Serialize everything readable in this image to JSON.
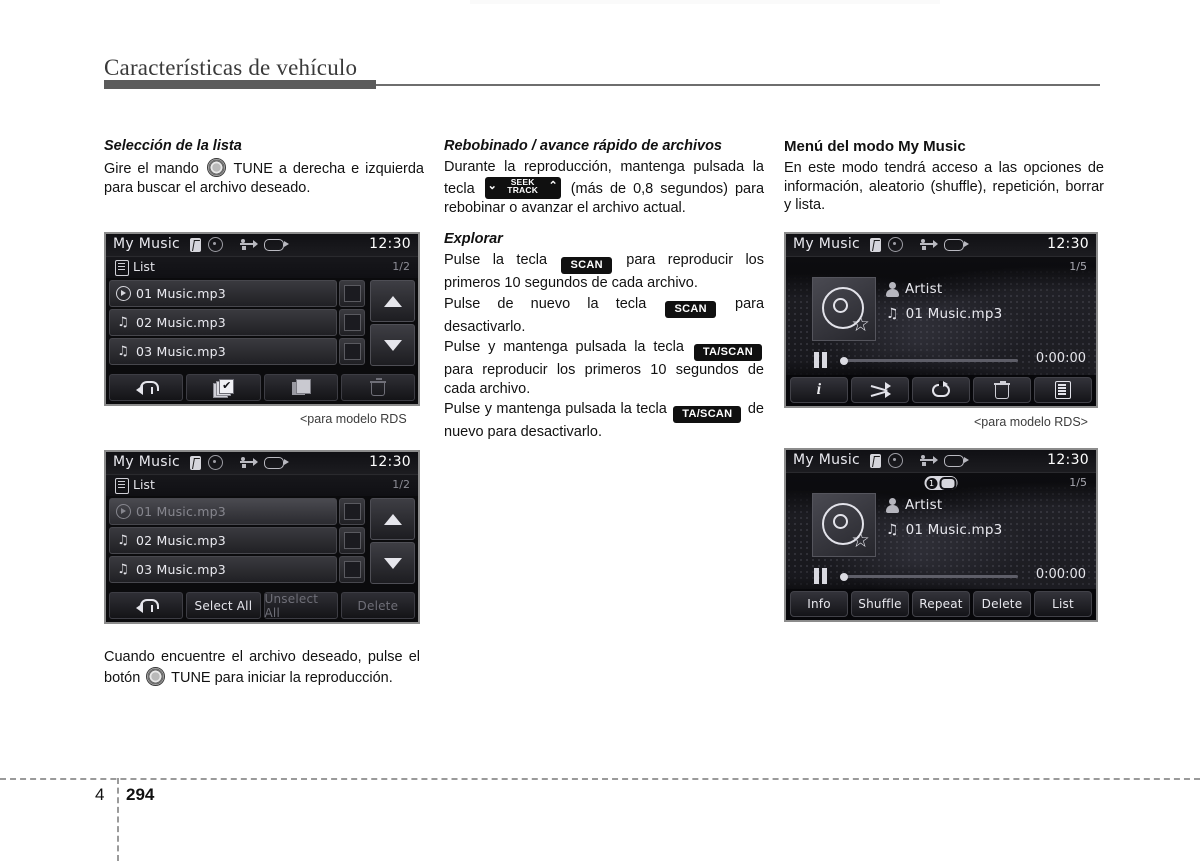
{
  "header": {
    "title": "Características de vehículo"
  },
  "footer": {
    "chapter": "4",
    "page": "294"
  },
  "col1": {
    "heading": "Selección de la lista",
    "para_a": "Gire el mando",
    "para_b": "TUNE a derecha e izquierda para buscar el archivo deseado.",
    "caption": "<para modelo RDS",
    "bottom_a": "Cuando encuentre el archivo deseado, pulse el botón",
    "bottom_b": "TUNE para iniciar la reproducción."
  },
  "col2": {
    "heading1": "Rebobinado / avance rápido de archivos",
    "p1_a": "Durante la reproducción, mantenga pulsada la tecla",
    "seek_key": {
      "line1": "SEEK",
      "line2": "TRACK",
      "left_chevron": "⌄",
      "right_chevron": "⌃"
    },
    "p1_b": "(más de 0,8 segundos) para rebobinar o avanzar el archivo actual.",
    "heading2": "Explorar",
    "p2_a": "Pulse la tecla",
    "scan_key": "SCAN",
    "p2_b": "para reproducir los primeros 10 segundos de cada archivo.",
    "p3_a": "Pulse de nuevo la tecla",
    "p3_b": "para desactivarlo.",
    "p4_a": "Pulse y mantenga pulsada la tecla",
    "tascan_key": "TA/SCAN",
    "p4_b": "para reproducir los primeros 10 segundos de cada archivo.",
    "p5_a": "Pulse y mantenga pulsada la tecla",
    "p5_b": "de nuevo para desactivarlo."
  },
  "col3": {
    "heading": "Menú del modo My Music",
    "para": "En este modo tendrá acceso a las opciones de información, aleatorio (shuffle), repetición, borrar y lista.",
    "caption": "<para modelo RDS>"
  },
  "screen_common": {
    "title": "My Music",
    "time": "12:30",
    "status_icons": [
      "bluetooth-icon",
      "disc-icon",
      "usb-icon",
      "device-icon"
    ]
  },
  "screen1": {
    "list_label": "List",
    "page_indicator": "1/2",
    "rows": [
      {
        "icon": "play-icon",
        "label": "01 Music.mp3"
      },
      {
        "icon": "note-icon",
        "label": "02 Music.mp3"
      },
      {
        "icon": "note-icon",
        "label": "03 Music.mp3"
      }
    ],
    "scroll_up": "▲",
    "scroll_down": "▼",
    "toolbar": [
      {
        "name": "back-button",
        "icon": "back-arrow-icon",
        "label": ""
      },
      {
        "name": "select-all-button",
        "icon": "select-all-icon",
        "label": ""
      },
      {
        "name": "stop-button",
        "icon": "stop-icon",
        "label": ""
      },
      {
        "name": "delete-button",
        "icon": "trash-icon",
        "label": ""
      }
    ]
  },
  "screen2": {
    "list_label": "List",
    "page_indicator": "1/2",
    "rows": [
      {
        "icon": "play-icon",
        "label": "01 Music.mp3",
        "dim": true
      },
      {
        "icon": "note-icon",
        "label": "02 Music.mp3",
        "dim": false
      },
      {
        "icon": "note-icon",
        "label": "03 Music.mp3",
        "dim": false
      }
    ],
    "scroll_up": "▲",
    "scroll_down": "▼",
    "toolbar": [
      {
        "name": "back-button",
        "label": ""
      },
      {
        "name": "select-all-button",
        "label": "Select All"
      },
      {
        "name": "unselect-all-button",
        "label": "Unselect All"
      },
      {
        "name": "delete-button",
        "label": "Delete"
      }
    ]
  },
  "screen3": {
    "page_indicator": "1/5",
    "artist": "Artist",
    "track": "01 Music.mp3",
    "elapsed": "0:00:00",
    "buttons": [
      {
        "name": "info-button",
        "icon": "info-icon"
      },
      {
        "name": "shuffle-button",
        "icon": "shuffle-icon"
      },
      {
        "name": "repeat-button",
        "icon": "repeat-icon"
      },
      {
        "name": "delete-button",
        "icon": "trash-icon"
      },
      {
        "name": "list-button",
        "icon": "list-icon"
      }
    ]
  },
  "screen4": {
    "page_indicator": "1/5",
    "repeat_badge": "1",
    "artist": "Artist",
    "track": "01 Music.mp3",
    "elapsed": "0:00:00",
    "buttons": [
      {
        "name": "info-button",
        "label": "Info"
      },
      {
        "name": "shuffle-button",
        "label": "Shuffle"
      },
      {
        "name": "repeat-button",
        "label": "Repeat"
      },
      {
        "name": "delete-button",
        "label": "Delete"
      },
      {
        "name": "list-button",
        "label": "List"
      }
    ]
  }
}
